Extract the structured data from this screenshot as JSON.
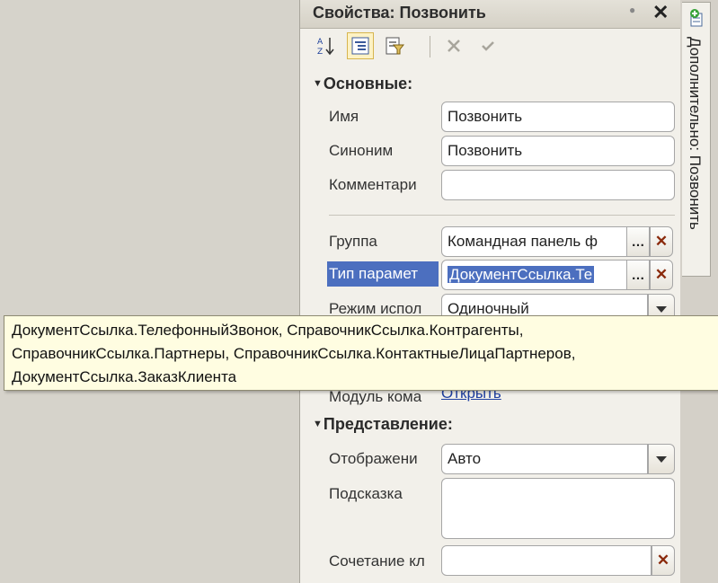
{
  "panel": {
    "title": "Свойства: Позвонить"
  },
  "sections": {
    "main": "Основные:",
    "view": "Представление:"
  },
  "properties": {
    "name": {
      "label": "Имя",
      "value": "Позвонить"
    },
    "synonym": {
      "label": "Синоним",
      "value": "Позвонить"
    },
    "comment": {
      "label": "Комментари",
      "value": ""
    },
    "group": {
      "label": "Группа",
      "value": "Командная панель ф"
    },
    "param_type": {
      "label": "Тип парамет",
      "value": "ДокументСсылка.Те"
    },
    "mode": {
      "label": "Режим испол",
      "value": "Одиночный"
    },
    "module": {
      "label": "Модуль кома",
      "link": "Открыть"
    },
    "display": {
      "label": "Отображени",
      "value": "Авто"
    },
    "tooltip_field": {
      "label": "Подсказка",
      "value": ""
    },
    "shortcut": {
      "label": "Сочетание кл",
      "value": ""
    }
  },
  "tooltip": {
    "lines": [
      "ДокументСсылка.ТелефонныйЗвонок, СправочникСсылка.Контрагенты,",
      "СправочникСсылка.Партнеры, СправочникСсылка.КонтактныеЛицаПартнеров,",
      "ДокументСсылка.ЗаказКлиента"
    ]
  },
  "side_tab": {
    "label": "Дополнительно: Позвонить"
  },
  "icons": {
    "close": "close-icon",
    "sort_alpha": "sort-alpha-icon",
    "categories": "categories-icon",
    "filter": "filter-icon",
    "cancel": "cancel-icon",
    "apply": "checkmark-icon",
    "add_tab": "add-icon"
  }
}
